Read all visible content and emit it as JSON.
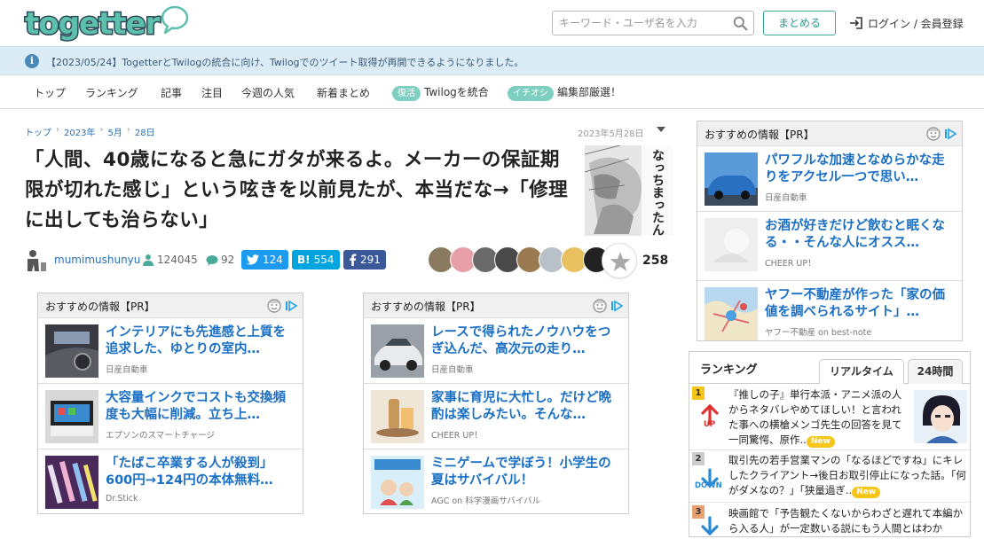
{
  "header": {
    "logo_text": "togetter",
    "search_placeholder": "キーワード・ユーザ名を入力",
    "matomeru_label": "まとめる",
    "login_label": "ログイン / 会員登録"
  },
  "notice": {
    "text": "【2023/05/24】TogetterとTwilogの統合に向け、Twilogでのツイート取得が再開できるようになりました。"
  },
  "nav": {
    "items": [
      "トップ",
      "ランキング",
      "記事",
      "注目",
      "今週の人気",
      "新着まとめ"
    ],
    "twilog_badge": "復活",
    "twilog_label": "Twilogを統合",
    "editor_badge": "イチオシ",
    "editor_label": "編集部厳選！"
  },
  "breadcrumb": [
    "トップ",
    "2023年",
    "5月",
    "28日"
  ],
  "article": {
    "date": "2023年5月28日",
    "title": "「人間、40歳になると急にガタが来るよ。メーカーの保証期限が切れた感じ」という呟きを以前見たが、本当だな→「修理に出しても治らない」",
    "thumb_caption": "なっちまったんだ",
    "author": "mumimushunyu",
    "views": "124045",
    "comments": "92",
    "tweets": "124",
    "hatena": "554",
    "facebook": "291",
    "favorites": "258",
    "hatena_logo": "B!"
  },
  "pr_label": "おすすめの情報【PR】",
  "pr_boxes": {
    "left": [
      {
        "title": "インテリアにも先進感と上質を追求した、ゆとりの室内…",
        "source": "日産自動車"
      },
      {
        "title": "大容量インクでコストも交換頻度も大幅に削減。立ち上…",
        "source": "エプソンのスマートチャージ"
      },
      {
        "title": "「たばこ卒業する人が殺到」600円→124円の本体無料…",
        "source": "Dr.Stick"
      }
    ],
    "middle": [
      {
        "title": "レースで得られたノウハウをつぎ込んだ、高次元の走り…",
        "source": "日産自動車"
      },
      {
        "title": "家事に育児に大忙し。だけど晩酌は楽しみたい。そんな…",
        "source": "CHEER UP！"
      },
      {
        "title": "ミニゲームで学ぼう！小学生の夏はサバイバル！",
        "source": "AGC on 科学漫画サバイバル"
      }
    ],
    "right": [
      {
        "title": "パワフルな加速となめらかな走りをアクセル一つで思い…",
        "source": "日産自動車"
      },
      {
        "title": "お酒が好きだけど飲むと眠くなる・・そんな人にオスス…",
        "source": "CHEER UP！"
      },
      {
        "title": "ヤフー不動産が作った「家の価値を調べられるサイト」…",
        "source": "ヤフー不動産 on best-note"
      }
    ]
  },
  "ranking": {
    "label": "ランキング",
    "tab_realtime": "リアルタイム",
    "tab_24h": "24時間",
    "new_label": "New",
    "items": [
      {
        "rank": "1",
        "direction": "UP",
        "text": "『推しの子』単行本派・アニメ派の人からネタバレやめてほしい！と言われた事への横槍メンゴ先生の回答を見て一同驚愕、原作..",
        "color": "#f5c518"
      },
      {
        "rank": "2",
        "direction": "DOWN",
        "text": "取引先の若手営業マンの「なるほどですね」にキレしたクライアント→後日お取引停止になった話。「何がダメなの？」「狭量過ぎ..",
        "color": "#cccccc"
      },
      {
        "rank": "3",
        "direction": "DOWN",
        "text": "映画館で「予告観たくないからわざと遅れて本編から入る人」が一定数いる説にもう人間とはわか",
        "color": "#e8a070"
      }
    ]
  },
  "colors": {
    "link_blue": "#1a6fc4",
    "accent_teal": "#3aa99a",
    "notice_bg": "#dcecf7",
    "up_red": "#e03030",
    "down_blue": "#2a8ad4"
  }
}
